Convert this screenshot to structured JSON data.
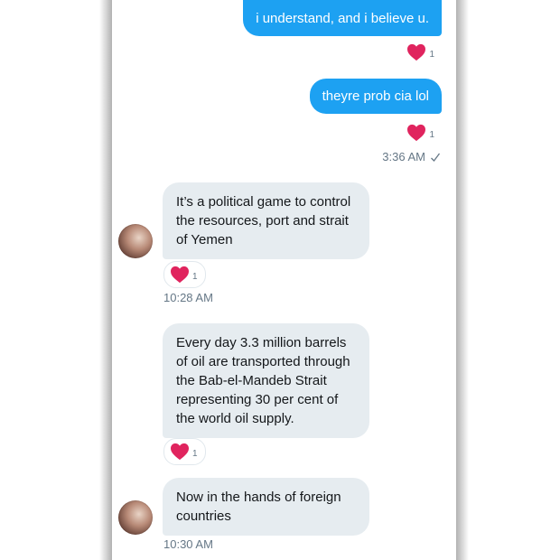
{
  "messages_sent": [
    {
      "text": "i understand, and i believe u.",
      "likes": "1"
    },
    {
      "text": "theyre prob cia lol",
      "likes": "1"
    }
  ],
  "sent_timestamp": "3:36 AM",
  "messages_received": [
    {
      "text": "It’s a political game to control the resources,  port and strait of Yemen",
      "likes": "1",
      "timestamp": "10:28 AM"
    },
    {
      "text": "Every day 3.3 million barrels of oil are transported through the Bab-el-Mandeb Strait representing 30 per cent of the world oil supply.",
      "likes": "1"
    },
    {
      "text": "Now in the hands of foreign countries",
      "timestamp": "10:30 AM"
    }
  ],
  "colors": {
    "sent_bubble": "#1da1f2",
    "received_bubble": "#e6ecf0",
    "heart": "#e0245e",
    "meta_text": "#657786"
  },
  "icons": {
    "like": "heart-icon",
    "read_receipt": "checkmark-icon",
    "avatar": "user-avatar"
  }
}
